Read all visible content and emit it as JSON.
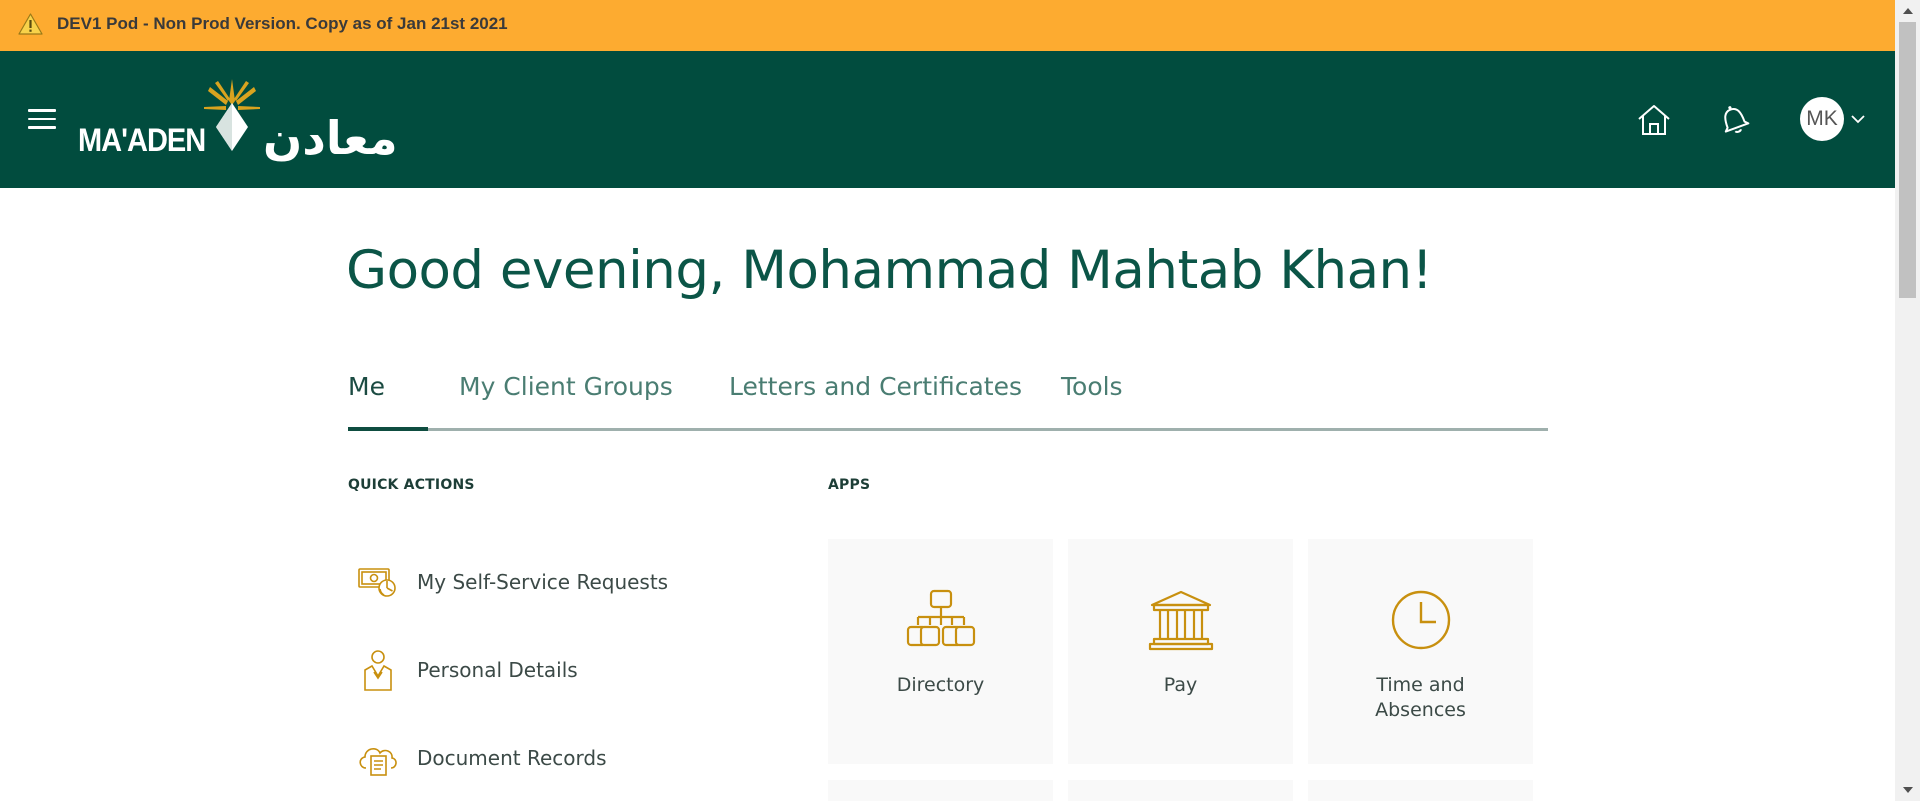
{
  "banner": {
    "text": "DEV1 Pod - Non Prod Version. Copy as of Jan 21st 2021",
    "icon": "warning-icon"
  },
  "header": {
    "logo_text": "MA'ADEN",
    "logo_arabic": "معادن",
    "avatar_initials": "MK",
    "icons": [
      "menu-icon",
      "home-icon",
      "bell-icon",
      "chevron-down-icon"
    ]
  },
  "greeting": "Good evening, Mohammad Mahtab Khan!",
  "tabs": [
    {
      "label": "Me",
      "active": true
    },
    {
      "label": "My Client Groups",
      "active": false
    },
    {
      "label": "Letters and Certificates",
      "active": false
    },
    {
      "label": "Tools",
      "active": false
    }
  ],
  "quick_actions": {
    "heading": "QUICK ACTIONS",
    "items": [
      {
        "label": "My Self-Service Requests",
        "icon": "requests-icon"
      },
      {
        "label": "Personal Details",
        "icon": "person-icon"
      },
      {
        "label": "Document Records",
        "icon": "cloud-document-icon"
      }
    ]
  },
  "apps": {
    "heading": "APPS",
    "items": [
      {
        "label": "Directory",
        "icon": "org-chart-icon"
      },
      {
        "label": "Pay",
        "icon": "bank-icon"
      },
      {
        "label": "Time and Absences",
        "icon": "clock-icon"
      }
    ]
  },
  "colors": {
    "banner": "#fdab30",
    "header": "#014c3e",
    "accent_icon": "#c8900f",
    "title": "#0b5547"
  }
}
